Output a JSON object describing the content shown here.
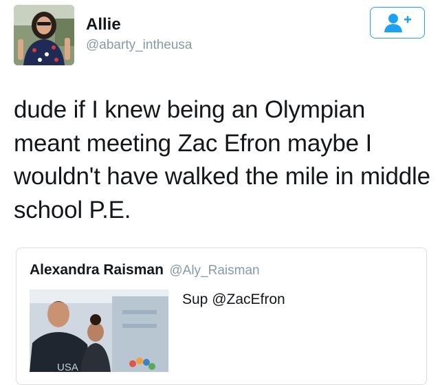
{
  "author": {
    "display_name": "Allie",
    "handle": "@abarty_intheusa"
  },
  "follow_button": {
    "icon": "add-user-icon",
    "color": "#1da1f2"
  },
  "tweet": {
    "text": "dude if I knew being an Olympian meant meeting Zac Efron maybe I wouldn't have walked the mile in middle school P.E."
  },
  "quoted_tweet": {
    "display_name": "Alexandra Raisman",
    "handle": "@Aly_Raisman",
    "text": "Sup @ZacEfron",
    "media_text": "USA"
  },
  "colors": {
    "text": "#14171a",
    "secondary": "#8899a6",
    "accent": "#1da1f2",
    "border": "#d8dee3"
  }
}
